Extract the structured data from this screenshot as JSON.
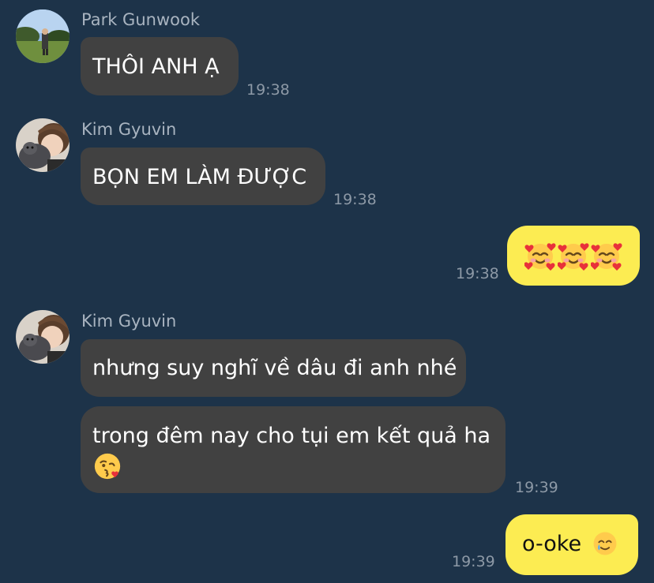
{
  "colors": {
    "background": "#1d3349",
    "incoming_bubble": "#414141",
    "outgoing_bubble": "#fcec52",
    "sender_name": "#a9b4c0",
    "timestamp": "#8d99a6"
  },
  "messages": [
    {
      "sender": "Park Gunwook",
      "avatar_icon": "park-gunwook-avatar",
      "text": "THÔI ANH Ạ",
      "time": "19:38",
      "direction": "incoming"
    },
    {
      "sender": "Kim Gyuvin",
      "avatar_icon": "kim-gyuvin-avatar",
      "text": "BỌN EM LÀM ĐƯỢC",
      "time": "19:38",
      "direction": "incoming"
    },
    {
      "sender": "me",
      "emojis": [
        "smiling-face-with-hearts-emoji",
        "smiling-face-with-hearts-emoji",
        "smiling-face-with-hearts-emoji"
      ],
      "time": "19:38",
      "direction": "outgoing"
    },
    {
      "sender": "Kim Gyuvin",
      "avatar_icon": "kim-gyuvin-avatar",
      "text": "nhưng suy nghĩ về dâu đi anh nhé",
      "direction": "incoming"
    },
    {
      "sender": "Kim Gyuvin",
      "text": "trong đêm nay cho tụi em kết quả ha",
      "emoji": "face-blowing-kiss-emoji",
      "time": "19:39",
      "direction": "incoming"
    },
    {
      "sender": "me",
      "text": "o-oke",
      "emoji": "smiling-face-with-tear-emoji",
      "time": "19:39",
      "direction": "outgoing"
    }
  ]
}
